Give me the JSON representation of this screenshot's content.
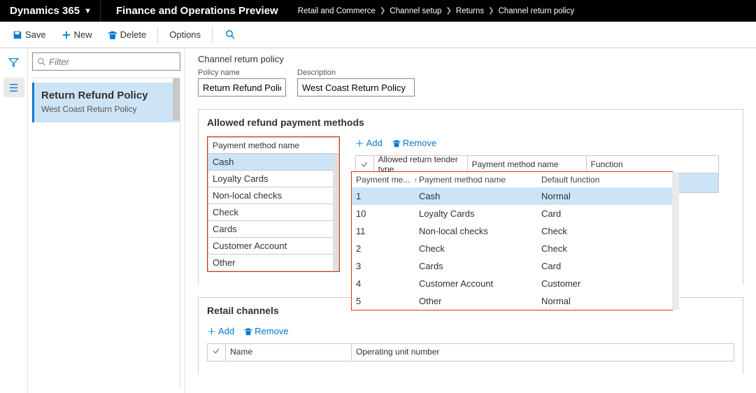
{
  "topbar": {
    "brand": "Dynamics 365",
    "subtitle": "Finance and Operations Preview",
    "breadcrumbs": [
      "Retail and Commerce",
      "Channel setup",
      "Returns",
      "Channel return policy"
    ]
  },
  "cmdbar": {
    "save": "Save",
    "new": "New",
    "delete": "Delete",
    "options": "Options"
  },
  "leftpane": {
    "filter_placeholder": "Filter",
    "card_title": "Return Refund Policy",
    "card_sub": "West Coast Return Policy"
  },
  "page": {
    "title": "Channel return policy",
    "policy_name_label": "Policy name",
    "policy_name_value": "Return Refund Policy",
    "description_label": "Description",
    "description_value": "West Coast Return Policy"
  },
  "section_allowed": {
    "title": "Allowed refund payment methods",
    "pm_header": "Payment method name",
    "pm_items": [
      "Cash",
      "Loyalty Cards",
      "Non-local checks",
      "Check",
      "Cards",
      "Customer Account",
      "Other"
    ],
    "add": "Add",
    "remove": "Remove",
    "grid_headers": {
      "c1": "Allowed return tender type",
      "c2": "Payment method name",
      "c3": "Function"
    },
    "editrow_function": "Normal",
    "dd_headers": {
      "h1": "Payment me...",
      "h2": "Payment method name",
      "h3": "Default function"
    },
    "dd_rows": [
      {
        "num": "1",
        "name": "Cash",
        "fn": "Normal"
      },
      {
        "num": "10",
        "name": "Loyalty Cards",
        "fn": "Card"
      },
      {
        "num": "11",
        "name": "Non-local checks",
        "fn": "Check"
      },
      {
        "num": "2",
        "name": "Check",
        "fn": "Check"
      },
      {
        "num": "3",
        "name": "Cards",
        "fn": "Card"
      },
      {
        "num": "4",
        "name": "Customer Account",
        "fn": "Customer"
      },
      {
        "num": "5",
        "name": "Other",
        "fn": "Normal"
      }
    ]
  },
  "section_channels": {
    "title": "Retail channels",
    "add": "Add",
    "remove": "Remove",
    "headers": {
      "name": "Name",
      "oun": "Operating unit number"
    }
  }
}
